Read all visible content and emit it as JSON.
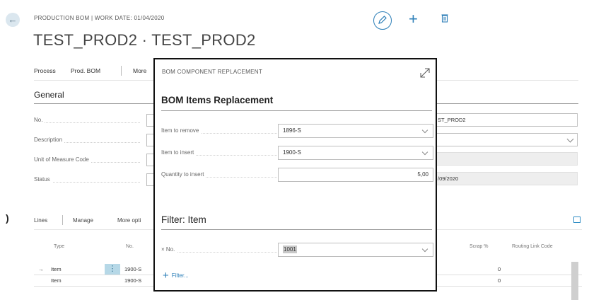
{
  "header": {
    "caption": "PRODUCTION BOM | WORK DATE: 01/04/2020",
    "title": "TEST_PROD2 · TEST_PROD2"
  },
  "menu": {
    "items": [
      "Process",
      "Prod. BOM",
      "More"
    ]
  },
  "general": {
    "title": "General",
    "fields": [
      {
        "label": "No.",
        "value": "ST_PROD2"
      },
      {
        "label": "Description",
        "value": ""
      },
      {
        "label": "Unit of Measure Code",
        "value": ""
      },
      {
        "label": "Status",
        "value": "/09/2020"
      }
    ]
  },
  "lines": {
    "tabs": [
      "Lines",
      "Manage",
      "More opti"
    ],
    "columns": {
      "type": "Type",
      "no": "No.",
      "scrap": "Scrap %",
      "routing_link": "Routing Link Code"
    },
    "rows": [
      {
        "arrow": "→",
        "type": "Item",
        "no": "1900-S",
        "scrap": "0"
      },
      {
        "arrow": "",
        "type": "Item",
        "no": "1900-S",
        "scrap": "0"
      }
    ]
  },
  "modal": {
    "caption": "BOM COMPONENT REPLACEMENT",
    "section1_title": "BOM Items Replacement",
    "item_to_remove_label": "Item to remove",
    "item_to_remove_value": "1896-S",
    "item_to_insert_label": "Item to insert",
    "item_to_insert_value": "1900-S",
    "quantity_label": "Quantity to insert",
    "quantity_value": "5,00",
    "section2_title": "Filter: Item",
    "filter_no_label": "× No.",
    "filter_no_value": "1001",
    "add_filter_label": "Filter..."
  },
  "colors": {
    "accent": "#2d7fb8",
    "modal_border": "#111111",
    "selected_row_menu": "#b6d8e7"
  },
  "left_marker": ")"
}
